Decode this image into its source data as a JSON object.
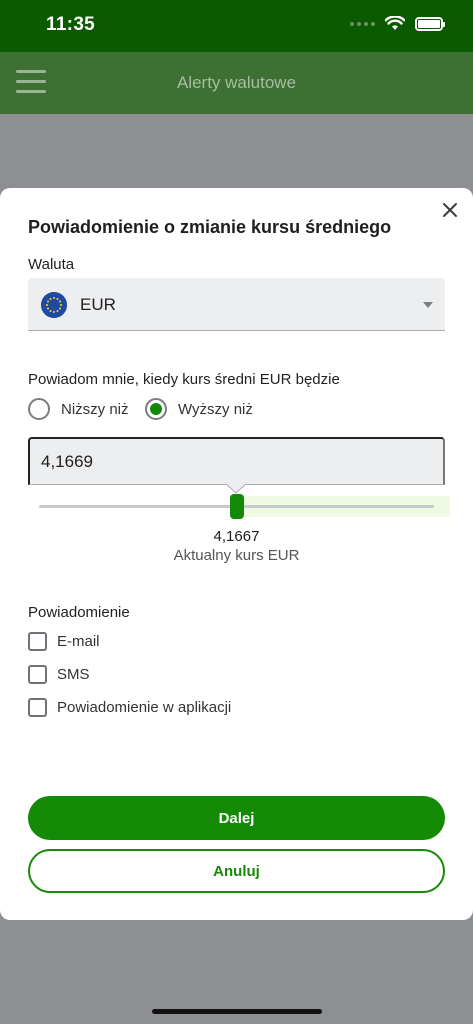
{
  "status_bar": {
    "time": "11:35"
  },
  "app_bar": {
    "title": "Alerty walutowe",
    "menu_icon": "hamburger-icon"
  },
  "modal": {
    "title": "Powiadomienie o zmianie kursu średniego",
    "close_icon": "close-icon",
    "currency": {
      "label": "Waluta",
      "selected": "EUR",
      "flag_icon": "eu-flag-icon"
    },
    "condition": {
      "label": "Powiadom mnie, kiedy kurs średni EUR będzie",
      "options": [
        {
          "label": "Niższy niż",
          "checked": false
        },
        {
          "label": "Wyższy niż",
          "checked": true
        }
      ]
    },
    "threshold_value": "4,1669",
    "slider": {
      "current_rate": "4,1667",
      "caption": "Aktualny kurs EUR"
    },
    "notification": {
      "label": "Powiadomienie",
      "options": [
        {
          "label": "E-mail",
          "checked": false
        },
        {
          "label": "SMS",
          "checked": false
        },
        {
          "label": "Powiadomienie w aplikacji",
          "checked": false
        }
      ]
    },
    "buttons": {
      "next": "Dalej",
      "cancel": "Anuluj"
    }
  },
  "colors": {
    "brand_green": "#148a07",
    "status_bar": "#0b5a00",
    "app_bar_dimmed": "#3d7032",
    "overlay": "#8d8f92"
  }
}
